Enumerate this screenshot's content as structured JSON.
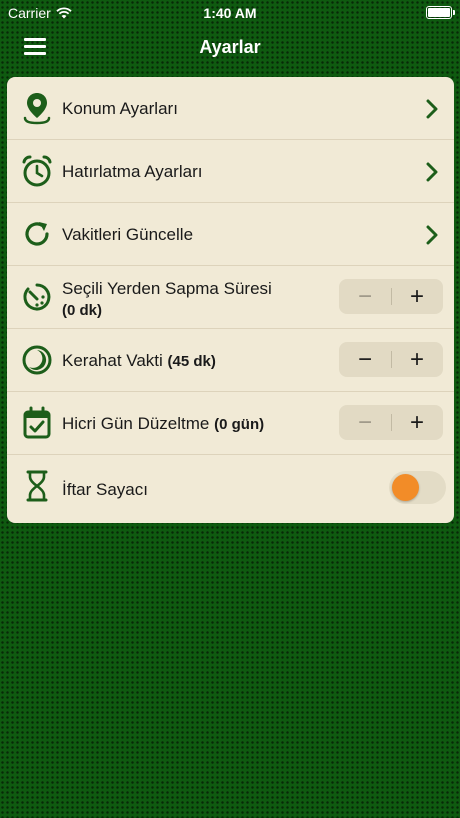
{
  "status_bar": {
    "carrier": "Carrier",
    "time": "1:40 AM"
  },
  "nav": {
    "title": "Ayarlar"
  },
  "colors": {
    "accent": "#1d5e1a",
    "background": "#0f5a10",
    "card": "#f1ead6",
    "toggle_knob": "#f28c28"
  },
  "settings": {
    "rows": [
      {
        "label": "Konum Ayarları",
        "icon": "location-pin-icon",
        "control": "chevron"
      },
      {
        "label": "Hatırlatma Ayarları",
        "icon": "alarm-clock-icon",
        "control": "chevron"
      },
      {
        "label": "Vakitleri Güncelle",
        "icon": "refresh-icon",
        "control": "chevron"
      },
      {
        "label": "Seçili Yerden Sapma Süresi",
        "value": "(0 dk)",
        "icon": "timer-icon",
        "control": "stepper",
        "minus": "−",
        "plus": "+"
      },
      {
        "label": "Kerahat Vakti",
        "value": "(45 dk)",
        "icon": "crescent-moon-icon",
        "control": "stepper",
        "minus": "−",
        "plus": "+"
      },
      {
        "label": "Hicri Gün Düzeltme",
        "value": "(0 gün)",
        "icon": "calendar-check-icon",
        "control": "stepper",
        "minus": "−",
        "plus": "+"
      },
      {
        "label": "İftar Sayacı",
        "icon": "hourglass-icon",
        "control": "toggle"
      }
    ]
  }
}
